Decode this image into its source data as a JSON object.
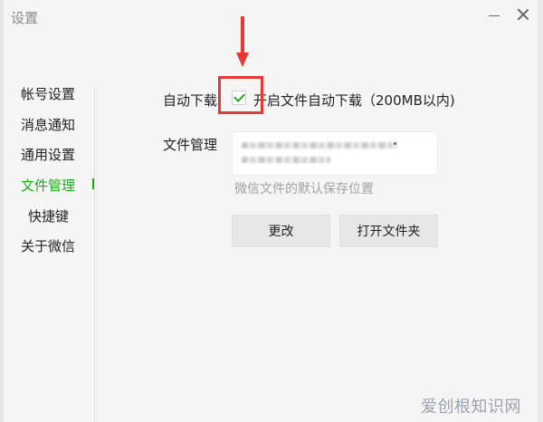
{
  "window": {
    "title": "设置",
    "minimize_icon": "minimize-icon",
    "close_icon": "close-icon"
  },
  "sidebar": {
    "items": [
      {
        "label": "帐号设置",
        "active": false
      },
      {
        "label": "消息通知",
        "active": false
      },
      {
        "label": "通用设置",
        "active": false
      },
      {
        "label": "文件管理",
        "active": true
      },
      {
        "label": "快捷键",
        "active": false
      },
      {
        "label": "关于微信",
        "active": false
      }
    ],
    "active_color": "#1aad19"
  },
  "auto_download": {
    "label": "自动下载",
    "checked": true,
    "checkbox_text": "开启文件自动下载（200MB以内)"
  },
  "file_management": {
    "label": "文件管理",
    "hint": "微信文件的默认保存位置"
  },
  "buttons": {
    "change": "更改",
    "open_folder": "打开文件夹"
  },
  "annotation": {
    "color": "#e53935",
    "arrow_icon": "arrow-down-icon"
  },
  "watermark": "爱创根知识网"
}
